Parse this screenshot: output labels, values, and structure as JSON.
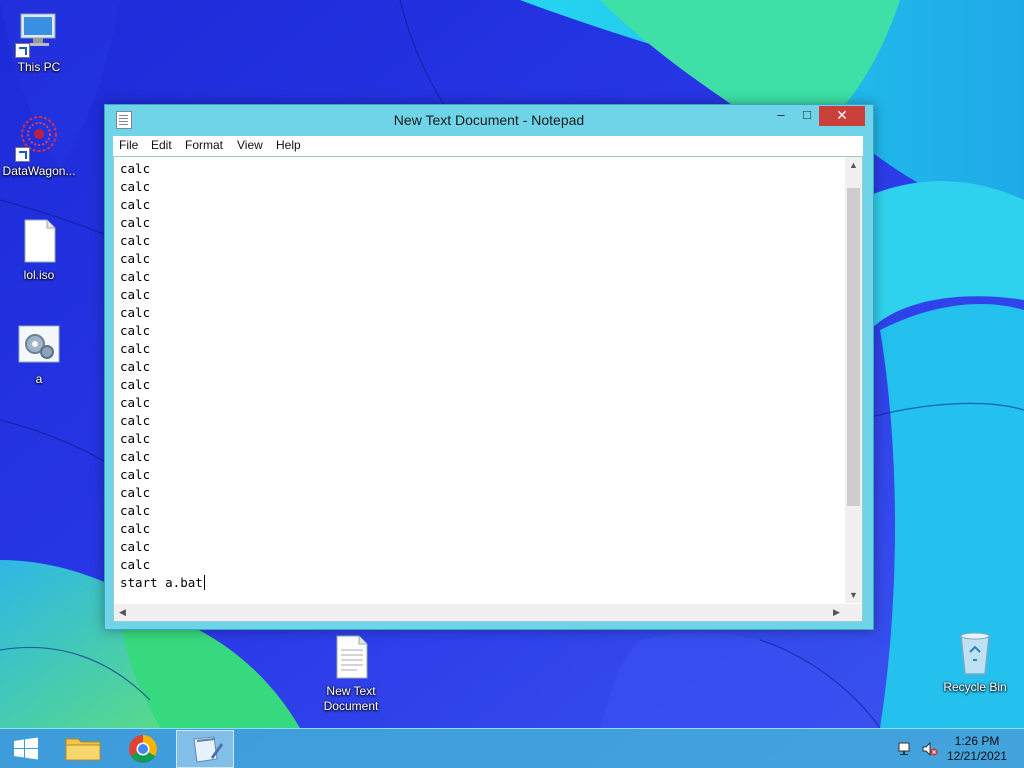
{
  "desktop": {
    "icons": [
      {
        "label": "This PC",
        "icon": "computer-icon"
      },
      {
        "label": "DataWagon...",
        "icon": "datawagon-shortcut-icon"
      },
      {
        "label": "lol.iso",
        "icon": "file-icon"
      },
      {
        "label": "a",
        "icon": "batch-file-icon"
      },
      {
        "label": "New Text Document",
        "icon": "text-file-icon"
      },
      {
        "label": "Recycle Bin",
        "icon": "recycle-bin-icon"
      }
    ]
  },
  "window": {
    "title": "New Text Document - Notepad",
    "controls": {
      "minimize": "–",
      "maximize": "□",
      "close": "✕"
    },
    "menu": [
      "File",
      "Edit",
      "Format",
      "View",
      "Help"
    ],
    "lines": [
      "calc",
      "calc",
      "calc",
      "calc",
      "calc",
      "calc",
      "calc",
      "calc",
      "calc",
      "calc",
      "calc",
      "calc",
      "calc",
      "calc",
      "calc",
      "calc",
      "calc",
      "calc",
      "calc",
      "calc",
      "calc",
      "calc",
      "calc",
      "start a.bat"
    ]
  },
  "taskbar": {
    "buttons": [
      "start-button",
      "file-explorer",
      "chrome",
      "notepad"
    ],
    "time": "1:26 PM",
    "date": "12/21/2021"
  },
  "colors": {
    "window_frame": "#6fd4e8",
    "close_button": "#c9403a",
    "taskbar": "#46bed7"
  }
}
